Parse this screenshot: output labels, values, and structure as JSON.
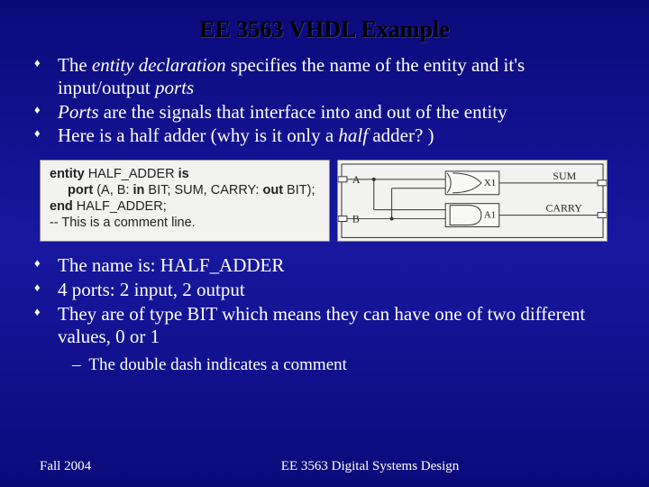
{
  "title": "EE 3563 VHDL Example",
  "bullets_top": [
    {
      "pre": "The ",
      "em1": "entity declaration",
      "mid": " specifies the name of the entity and it's input/output ",
      "em2": "ports",
      "post": ""
    },
    {
      "pre": "",
      "em1": "Ports",
      "mid": " are the signals that interface into and out of the entity",
      "em2": "",
      "post": ""
    },
    {
      "pre": "Here is a half adder  (why is it only a ",
      "em1": "half",
      "mid": " adder? )",
      "em2": "",
      "post": ""
    }
  ],
  "code": {
    "l1a": "entity",
    "l1b": " HALF_ADDER ",
    "l1c": "is",
    "l2a": "port",
    "l2b": " (A, B: ",
    "l2c": "in",
    "l2d": " BIT; SUM, CARRY: ",
    "l2e": "out",
    "l2f": " BIT);",
    "l3a": "end",
    "l3b": " HALF_ADDER;",
    "l4": "-- This is a comment line."
  },
  "diagram": {
    "A": "A",
    "B": "B",
    "X1": "X1",
    "A1": "A1",
    "SUM": "SUM",
    "CARRY": "CARRY"
  },
  "bullets_bottom": [
    "The name is:  HALF_ADDER",
    "4 ports: 2 input, 2 output",
    "They are of type BIT which means they can have one of two different values, 0 or 1"
  ],
  "subbullet": "The double dash indicates a comment",
  "footer": {
    "left": "Fall 2004",
    "center": "EE 3563 Digital Systems Design"
  }
}
